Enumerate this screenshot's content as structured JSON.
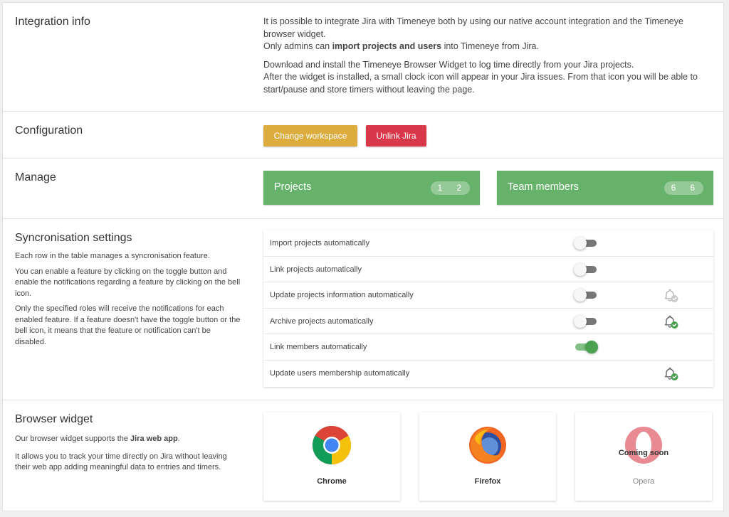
{
  "integration": {
    "title": "Integration info",
    "p1": "It is possible to integrate Jira with Timeneye both by using our native account integration and the Timeneye browser widget.",
    "p2_before": "Only admins can ",
    "p2_bold": "import projects and users",
    "p2_after": " into Timeneye from Jira.",
    "p3": "Download and install the Timeneye Browser Widget to log time directly from your Jira projects.",
    "p4": "After the widget is installed, a small clock icon will appear in your Jira issues. From that icon you will be able to start/pause and store timers without leaving the page."
  },
  "configuration": {
    "title": "Configuration",
    "change_workspace": "Change workspace",
    "unlink": "Unlink Jira",
    "colors": {
      "warning": "#dcac3e",
      "danger": "#d9374a"
    }
  },
  "manage": {
    "title": "Manage",
    "projects": {
      "label": "Projects",
      "count_a": "1",
      "count_b": "2"
    },
    "team": {
      "label": "Team members",
      "count_a": "6",
      "count_b": "6"
    },
    "accent": "#67b26a"
  },
  "sync": {
    "title": "Syncronisation settings",
    "d1": "Each row in the table manages a syncronisation feature.",
    "d2": "You can enable a feature by clicking on the toggle button and enable the notifications regarding a feature by clicking on the bell icon.",
    "d3": "Only the specified roles will receive the notifications for each enabled feature. If a feature doesn't have the toggle button or the bell icon, it means that the feature or notification can't be disabled.",
    "rows": [
      {
        "label": "Import projects automatically",
        "toggle": "off",
        "bell": "none"
      },
      {
        "label": "Link projects automatically",
        "toggle": "off",
        "bell": "none"
      },
      {
        "label": "Update projects information automatically",
        "toggle": "off",
        "bell": "disabled"
      },
      {
        "label": "Archive projects automatically",
        "toggle": "off",
        "bell": "enabled"
      },
      {
        "label": "Link members automatically",
        "toggle": "on",
        "bell": "none"
      },
      {
        "label": "Update users membership automatically",
        "toggle": "none",
        "bell": "enabled"
      }
    ]
  },
  "widget": {
    "title": "Browser widget",
    "d1_before": "Our browser widget supports the ",
    "d1_bold": "Jira web app",
    "d1_after": ".",
    "d2": "It allows you to track your time directly on Jira without leaving their web app adding meaningful data to entries and timers.",
    "browsers": [
      {
        "name": "Chrome",
        "icon": "chrome-icon"
      },
      {
        "name": "Firefox",
        "icon": "firefox-icon"
      },
      {
        "name": "Opera",
        "icon": "opera-icon",
        "badge": "Coming soon"
      }
    ]
  }
}
